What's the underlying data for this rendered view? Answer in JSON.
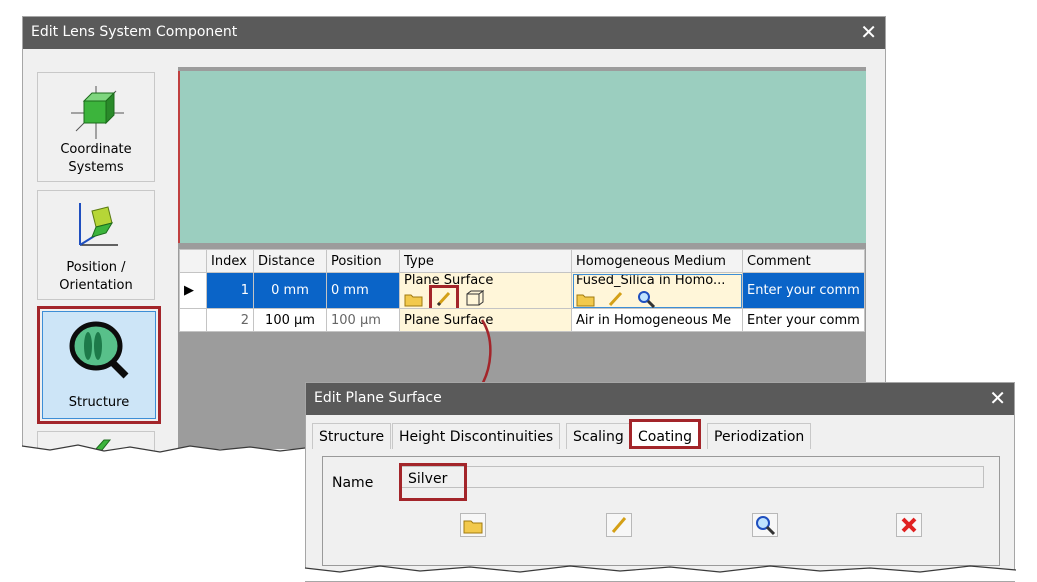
{
  "main_window": {
    "title": "Edit Lens System Component",
    "sidebar": [
      {
        "label_line1": "Coordinate",
        "label_line2": "Systems"
      },
      {
        "label_line1": "Position /",
        "label_line2": "Orientation"
      },
      {
        "label_line1": "Structure",
        "label_line2": ""
      }
    ],
    "table": {
      "headers": [
        "Index",
        "Distance",
        "Position",
        "Type",
        "Homogeneous Medium",
        "Comment"
      ],
      "rows": [
        {
          "index": "1",
          "distance": "0 mm",
          "position": "0 mm",
          "type": "Plane Surface",
          "medium": "Fused_Silica in Homo...",
          "comment": "Enter your comm"
        },
        {
          "index": "2",
          "distance": "100 µm",
          "position": "100 µm",
          "type": "Plane Surface",
          "medium": "Air in Homogeneous Me",
          "comment": "Enter your comm"
        }
      ]
    }
  },
  "dialog": {
    "title": "Edit Plane Surface",
    "tabs": [
      "Structure",
      "Height Discontinuities",
      "Scaling",
      "Coating",
      "Periodization"
    ],
    "active_tab": "Coating",
    "name_label": "Name",
    "name_value": "Silver"
  },
  "colors": {
    "highlight": "#a3252a",
    "selection": "#0a64c8",
    "preview": "#9bcebf",
    "titlebar": "#5a5a5a"
  }
}
